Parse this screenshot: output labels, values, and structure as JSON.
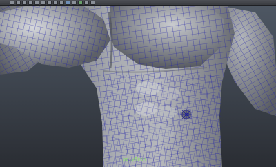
{
  "viewport": {
    "object_label": "polyTrek",
    "wire_color": "#2020a0",
    "surface_color": "#a3a6ab",
    "background_top": "#4e5763",
    "background_bottom": "#2a2d33"
  },
  "toolbar": {
    "icons": [
      "tool-icon",
      "tool-icon",
      "tool-icon",
      "tool-icon",
      "tool-icon",
      "tool-icon",
      "tool-icon",
      "tool-icon",
      "tool-icon",
      "tool-icon",
      "tool-icon",
      "tool-icon",
      "tool-icon",
      "tool-icon"
    ]
  }
}
